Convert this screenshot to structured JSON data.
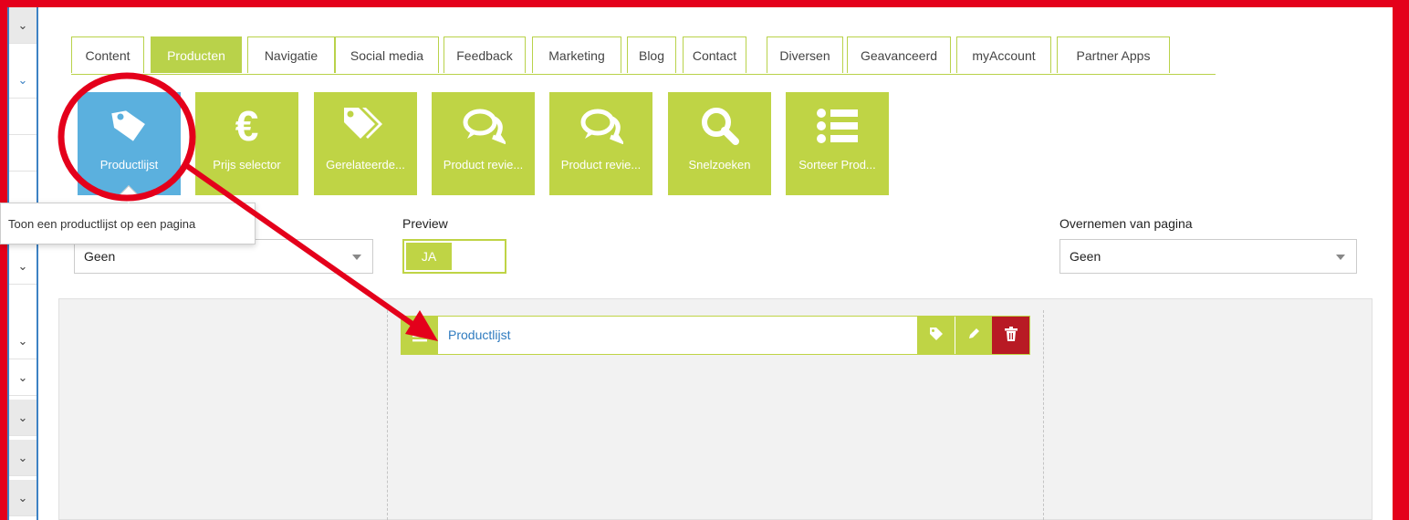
{
  "colors": {
    "accent_green": "#bfd445",
    "active_blue": "#5bb0de",
    "frame_red": "#e4001b",
    "link_blue": "#2f7bbf",
    "delete_red": "#b81a24"
  },
  "tabs": [
    {
      "label": "Content"
    },
    {
      "label": "Producten"
    },
    {
      "label": "Navigatie"
    },
    {
      "label": "Social media"
    },
    {
      "label": "Feedback"
    },
    {
      "label": "Marketing"
    },
    {
      "label": "Blog"
    },
    {
      "label": "Contact"
    },
    {
      "label": "Diversen"
    },
    {
      "label": "Geavanceerd"
    },
    {
      "label": "myAccount"
    },
    {
      "label": "Partner Apps"
    }
  ],
  "active_tab": "Producten",
  "widgets": [
    {
      "label": "Productlijst",
      "icon": "tag-icon"
    },
    {
      "label": "Prijs selector",
      "icon": "euro-icon"
    },
    {
      "label": "Gerelateerde...",
      "icon": "tags-icon"
    },
    {
      "label": "Product revie...",
      "icon": "comments-icon"
    },
    {
      "label": "Product revie...",
      "icon": "comments-icon"
    },
    {
      "label": "Snelzoeken",
      "icon": "search-icon"
    },
    {
      "label": "Sorteer Prod...",
      "icon": "list-icon"
    }
  ],
  "tooltip": "Toon een productlijst op een pagina",
  "left_select": {
    "value": "Geen"
  },
  "preview": {
    "label": "Preview",
    "value": "JA"
  },
  "overnemen": {
    "label": "Overnemen van pagina",
    "value": "Geen"
  },
  "placed_widget": {
    "title": "Productlijst"
  }
}
